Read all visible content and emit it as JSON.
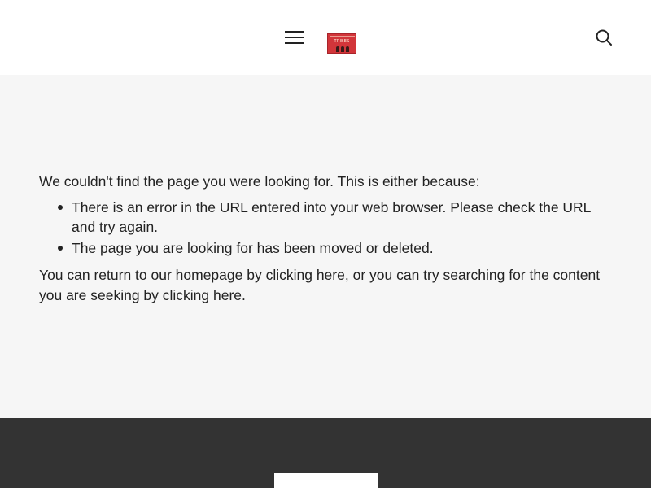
{
  "header": {
    "menu_icon": "hamburger-menu-icon",
    "logo_text": "TRIBES",
    "search_icon": "magnifier-search-icon"
  },
  "main": {
    "intro": "We couldn't find the page you were looking for. This is either because:",
    "reasons": [
      "There is an error in the URL entered into your web browser. Please check the URL and try again.",
      "The page you are looking for has been moved or deleted."
    ],
    "return_text_1": "You can return to our homepage by ",
    "homepage_link": "clicking here",
    "return_text_2": ", or you can try searching for the content you are seeking by ",
    "search_link": "clicking here",
    "return_text_3": "."
  },
  "colors": {
    "header_bg": "#ffffff",
    "main_bg": "#f6f6f6",
    "footer_bg": "#333333",
    "text": "#222222",
    "logo_red": "#d2353a"
  }
}
